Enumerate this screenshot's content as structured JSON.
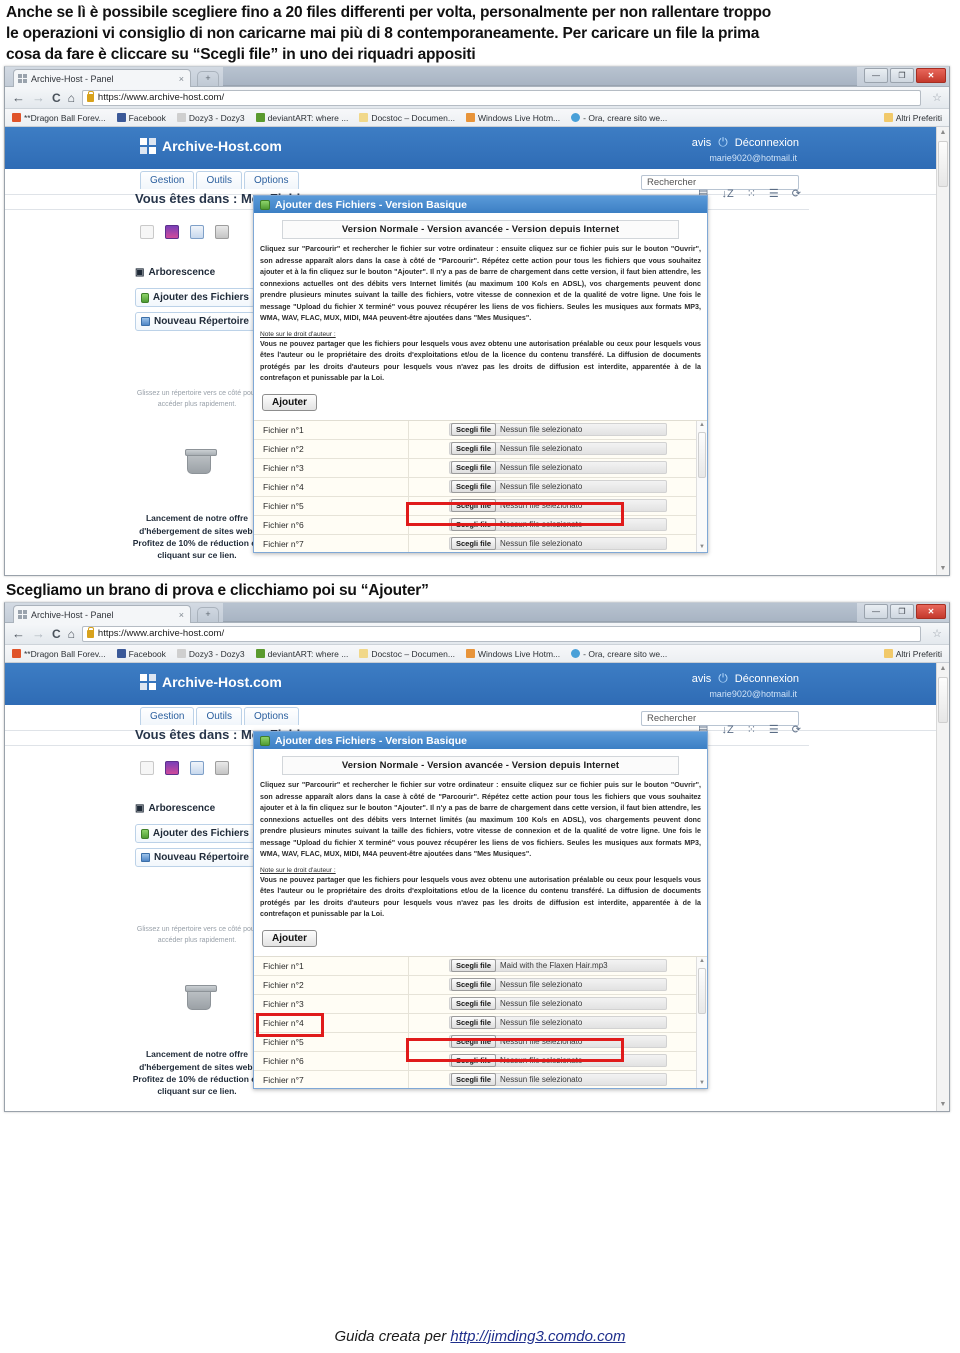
{
  "document": {
    "intro_lines": [
      "Anche se lì è possibile scegliere fino a 20 files differenti per volta, personalmente per non rallentare troppo",
      "le operazioni vi consiglio di non caricarne mai più di 8 contemporaneamente. Per caricare un file la prima",
      "cosa da fare è cliccare su “Scegli file” in uno dei riquadri appositi"
    ],
    "caption_second": "Scegliamo un brano di prova e clicchiamo poi su “Ajouter”",
    "footer_prefix": "Guida creata per ",
    "footer_link": "http://jimding3.comdo.com"
  },
  "browser": {
    "tab": {
      "title": "Archive-Host - Panel",
      "close_glyph": "×",
      "favicon": "windows-logo-icon"
    },
    "newtab_label": "+",
    "window_controls": {
      "minimize": "—",
      "maximize": "❐",
      "close": "✕"
    },
    "nav": {
      "back": "←",
      "forward": "→",
      "reload": "C",
      "home": "⌂",
      "url": "https://www.archive-host.com/",
      "star": "☆"
    },
    "bookmarks": [
      {
        "label": "**Dragon Ball Forev...",
        "color": "#e0542a"
      },
      {
        "label": "Facebook",
        "color": "#3b5998"
      },
      {
        "label": "Dozy3 - Dozy3",
        "color": "#cfcfcf"
      },
      {
        "label": "deviantART: where ...",
        "color": "#5a9a2e"
      },
      {
        "label": "Docstoc – Documen...",
        "color": "#f1d88a"
      },
      {
        "label": "Windows Live Hotm...",
        "color": "#e8943a"
      },
      {
        "label": "- Ora, creare sito we...",
        "color": "#49a0d8"
      }
    ],
    "bookmarks_overflow": {
      "label": "Altri Preferiti",
      "color": "#f1c96a"
    }
  },
  "archive_host": {
    "brand": "Archive-Host.com",
    "account_name": "avis",
    "logout_label": "Déconnexion",
    "email": "marie9020@hotmail.it",
    "menu_tabs": [
      "Gestion",
      "Outils",
      "Options"
    ],
    "search_placeholder": "Rechercher",
    "breadcrumb": "Vous êtes dans : Mes Fichiers",
    "tree_label": "Arborescence",
    "buttons": [
      {
        "label": "Ajouter des Fichiers",
        "icon": "add-file-icon"
      },
      {
        "label": "Nouveau Répertoire",
        "icon": "new-folder-icon"
      }
    ],
    "drag_hint_line1": "Glissez un répertoire vers ce côté pour",
    "drag_hint_line2": "accéder plus rapidement.",
    "trash_icon": "trash-icon",
    "promo_lines": [
      "Lancement de notre offre",
      "d'hébergement de sites web.",
      "Profitez de 10% de réduction en",
      "cliquant sur ce lien."
    ],
    "toolbar_icons": [
      "page-icon",
      "image-icon",
      "document-icon",
      "archive-icon"
    ],
    "right_icons": [
      "list-icon",
      "sort-az-icon",
      "filter-icon",
      "details-icon",
      "refresh-icon"
    ]
  },
  "dialog": {
    "title": "Ajouter des Fichiers - Version Basique",
    "version_bar": "Version Normale - Version avancée - Version depuis Internet",
    "instructions": "Cliquez sur \"Parcourir\" et rechercher le fichier sur votre ordinateur : ensuite cliquez sur ce fichier puis sur le bouton \"Ouvrir\", son adresse apparaît alors dans la case à côté de \"Parcourir\". Répétez cette action pour tous les fichiers que vous souhaitez ajouter et à la fin cliquez sur le bouton \"Ajouter\". Il n'y a pas de barre de chargement dans cette version, il faut bien attendre, les connexions actuelles ont des débits vers Internet limités (au maximum 100 Ko/s en ADSL), vos chargements peuvent donc prendre plusieurs minutes suivant la taille des fichiers, votre vitesse de connexion et de la qualité de votre ligne. Une fois le message \"Upload du fichier X terminé\" vous pouvez récupérer les liens de vos fichiers. Seules les musiques aux formats MP3, WMA, WAV, FLAC, MUX, MIDI, M4A peuvent-être ajoutées dans \"Mes Musiques\".",
    "copyright_heading": "Note sur le droit d'auteur :",
    "copyright_text": "Vous ne pouvez partager que les fichiers pour lesquels vous avez obtenu une autorisation préalable ou ceux pour lesquels vous êtes l'auteur ou le propriétaire des droits d'exploitations et/ou de la licence du contenu transféré. La diffusion de documents protégés par les droits d'auteurs pour lesquels vous n'avez pas les droits de diffusion est interdite, apparentée à de la contrefaçon et punissable par la Loi.",
    "add_button": "Ajouter",
    "chooser_label": "Scegli file",
    "no_file_text": "Nessun file selezionato",
    "scroll_up": "▲",
    "scroll_down": "▼"
  },
  "screenshot_one": {
    "rows": [
      {
        "label": "Fichier n°1",
        "value": "Nessun file selezionato",
        "highlighted": true
      },
      {
        "label": "Fichier n°2",
        "value": "Nessun file selezionato",
        "highlighted": false
      },
      {
        "label": "Fichier n°3",
        "value": "Nessun file selezionato",
        "highlighted": false
      },
      {
        "label": "Fichier n°4",
        "value": "Nessun file selezionato",
        "highlighted": false
      },
      {
        "label": "Fichier n°5",
        "value": "Nessun file selezionato",
        "highlighted": false
      },
      {
        "label": "Fichier n°6",
        "value": "Nessun file selezionato",
        "highlighted": false
      },
      {
        "label": "Fichier n°7",
        "value": "Nessun file selezionato",
        "highlighted": false
      }
    ]
  },
  "screenshot_two": {
    "rows": [
      {
        "label": "Fichier n°1",
        "value": "Maid with the Flaxen Hair.mp3",
        "highlighted": true
      },
      {
        "label": "Fichier n°2",
        "value": "Nessun file selezionato",
        "highlighted": false
      },
      {
        "label": "Fichier n°3",
        "value": "Nessun file selezionato",
        "highlighted": false
      },
      {
        "label": "Fichier n°4",
        "value": "Nessun file selezionato",
        "highlighted": false
      },
      {
        "label": "Fichier n°5",
        "value": "Nessun file selezionato",
        "highlighted": false
      },
      {
        "label": "Fichier n°6",
        "value": "Nessun file selezionato",
        "highlighted": false
      },
      {
        "label": "Fichier n°7",
        "value": "Nessun file selezionato",
        "highlighted": false
      }
    ]
  },
  "colors": {
    "accent_blue": "#3d7dc4",
    "highlight_red": "#e01b1b",
    "link_blue": "#1f2f8c"
  }
}
